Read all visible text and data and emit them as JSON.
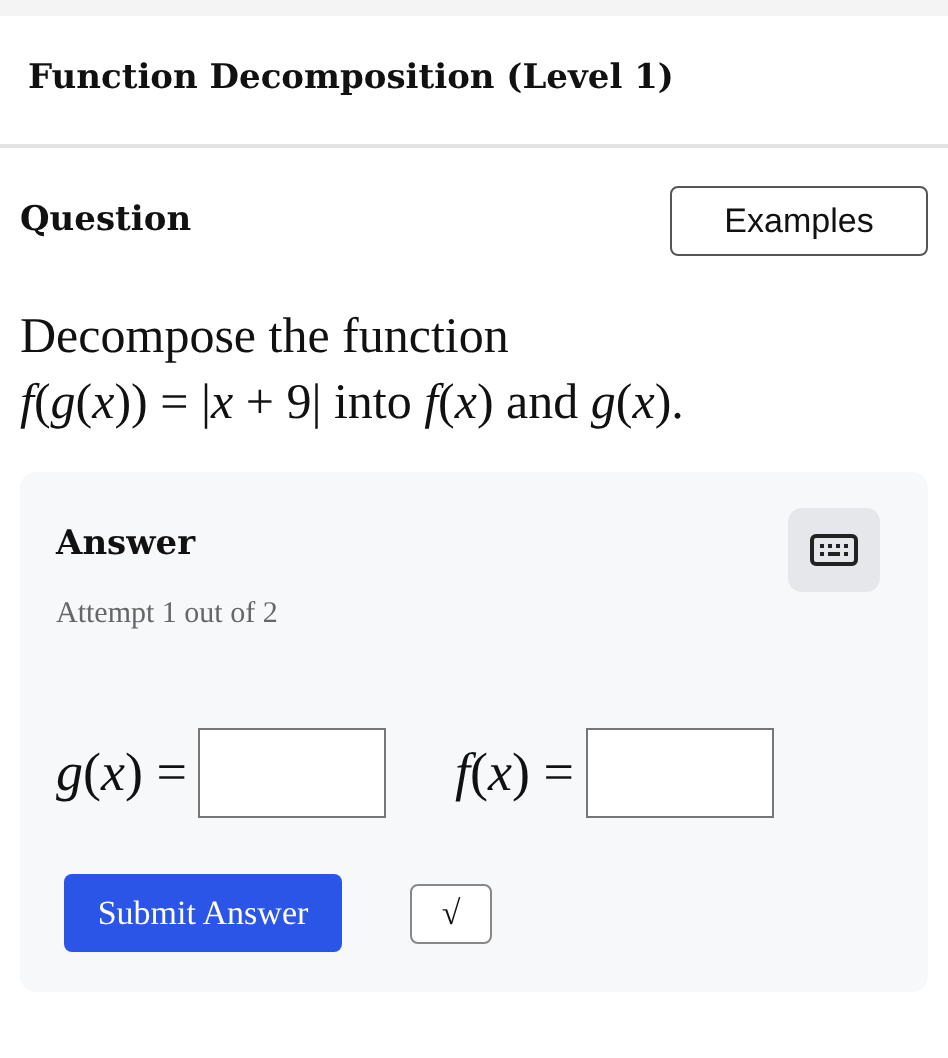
{
  "header": {
    "title": "Function Decomposition (Level 1)"
  },
  "question": {
    "heading": "Question",
    "examples_button": "Examples",
    "lines": [
      "Decompose the function",
      "*f*(*g*(*x*)) = |*x* + 9| into *f*(*x*) and *g*(*x*)."
    ]
  },
  "answer": {
    "heading": "Answer",
    "attempt": "Attempt 1 out of 2",
    "fields": [
      {
        "label": "*g*(*x*) ="
      },
      {
        "label": "*f*(*x*) ="
      }
    ],
    "submit_button": "Submit Answer",
    "sqrt_button": "√"
  }
}
